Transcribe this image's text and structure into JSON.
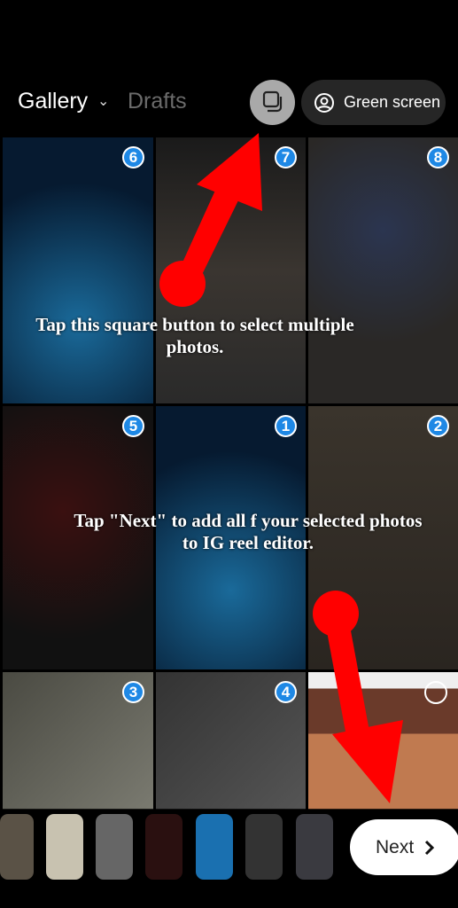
{
  "header": {
    "gallery_label": "Gallery",
    "drafts_label": "Drafts",
    "green_screen_label": "Green screen",
    "icons": {
      "gallery": "chevron-down-icon",
      "multi": "multi-select-squares-icon",
      "green": "person-circle-icon"
    }
  },
  "grid": {
    "badges": [
      "6",
      "7",
      "8",
      "5",
      "1",
      "2",
      "3",
      "4",
      ""
    ]
  },
  "annotations": {
    "top": "Tap this square button to select multiple photos.",
    "middle": "Tap \"Next\" to add all f your selected photos to IG reel editor.",
    "arrow_color": "#ff0000"
  },
  "bottom": {
    "next_label": "Next",
    "next_icon": "chevron-right-icon"
  },
  "colors": {
    "badge": "#1e88e5",
    "background": "#000000"
  }
}
